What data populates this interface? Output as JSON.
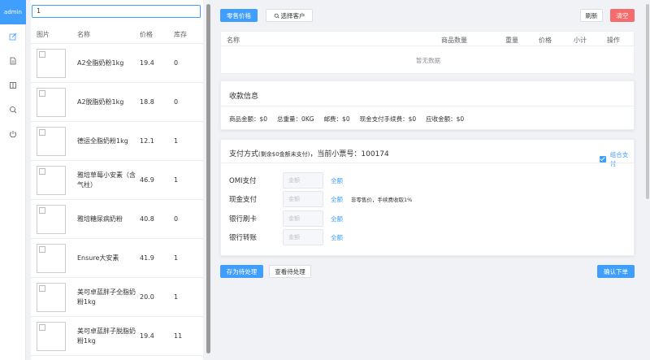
{
  "nav": {
    "brand": "admin",
    "items": [
      {
        "icon": "edit-icon"
      },
      {
        "icon": "document-icon"
      },
      {
        "icon": "book-icon"
      },
      {
        "icon": "search-icon"
      },
      {
        "icon": "power-icon"
      }
    ]
  },
  "search": {
    "value": "1"
  },
  "products": {
    "headers": {
      "image": "图片",
      "name": "名称",
      "price": "价格",
      "stock": "库存"
    },
    "rows": [
      {
        "name": "A2全脂奶粉1kg",
        "price": "19.4",
        "stock": "0"
      },
      {
        "name": "A2脱脂奶粉1kg",
        "price": "18.8",
        "stock": "0"
      },
      {
        "name": "德运全脂奶粉1kg",
        "price": "12.1",
        "stock": "1"
      },
      {
        "name": "雅培草莓小安素（含气柱）",
        "price": "46.9",
        "stock": "1"
      },
      {
        "name": "雅培糖尿病奶粉",
        "price": "40.8",
        "stock": "0"
      },
      {
        "name": "Ensure大安素",
        "price": "41.9",
        "stock": "1"
      },
      {
        "name": "美可卓蓝胖子全脂奶粉1kg",
        "price": "20.0",
        "stock": "1"
      },
      {
        "name": "美可卓蓝胖子脱脂奶粉1kg",
        "price": "19.4",
        "stock": "11"
      }
    ]
  },
  "toolbar": {
    "retail_price": "零售价格",
    "select_customer": "选择客户",
    "refresh": "刷新",
    "clear": "清空"
  },
  "cart": {
    "headers": {
      "name": "名称",
      "qty": "商品数量",
      "weight": "重量",
      "price": "价格",
      "subtotal": "小计",
      "action": "操作"
    },
    "empty": "暂无数据"
  },
  "summary": {
    "title": "收款信息",
    "goods_amount": "商品金额：$0",
    "total_weight": "总重量：0KG",
    "postage": "邮费：$0",
    "cash_fee": "现金支付手续费：$0",
    "receivable": "应收金额：$0"
  },
  "payment": {
    "title_prefix": "支付方式",
    "title_remaining": "(剩余$0金额未支付)",
    "title_ticket": "，当前小票号：100174",
    "combo_label": "组合支付",
    "amount_placeholder": "金额",
    "all_label": "全额",
    "cash_note": "非零售价，手续费收取1%",
    "methods": [
      {
        "label": "OMI支付"
      },
      {
        "label": "现金支付"
      },
      {
        "label": "银行刷卡"
      },
      {
        "label": "银行转账"
      }
    ]
  },
  "footer": {
    "save_pending": "存为待处理",
    "view_pending": "查看待处理",
    "confirm": "确认下单"
  },
  "colors": {
    "primary": "#409eff",
    "danger": "#f56c6c"
  }
}
